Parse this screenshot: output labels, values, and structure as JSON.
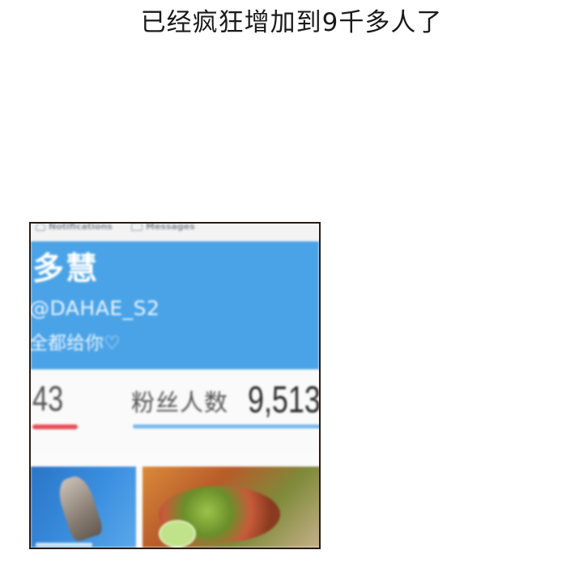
{
  "caption": "已经疯狂增加到9千多人了",
  "nav": {
    "notifications_label": "Notifications",
    "messages_label": "Messages",
    "notifications_icon": "bell-icon",
    "messages_icon": "mail-icon"
  },
  "profile": {
    "name": "多慧",
    "handle": "@DAHAE_S2",
    "bio": "全都给你♡",
    "following_count": "43",
    "followers_label": "粉丝人数",
    "followers_count": "9,513"
  },
  "colors": {
    "hero_blue": "#4aa3e6",
    "following_bar": "#e8505b",
    "followers_bar": "#7ab8ea"
  }
}
